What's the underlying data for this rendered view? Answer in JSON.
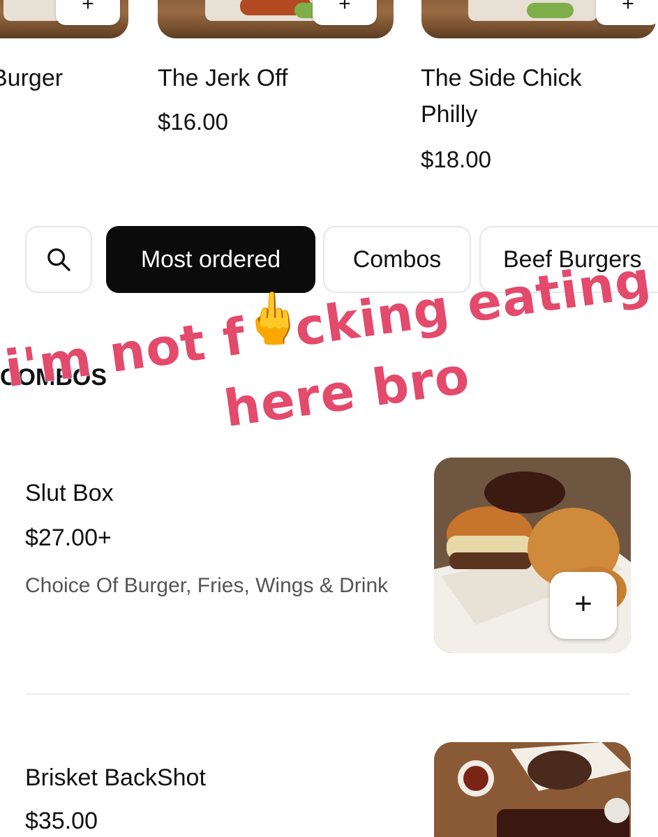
{
  "carousel": {
    "items": [
      {
        "name": "Burger",
        "price": ""
      },
      {
        "name": "The Jerk Off",
        "price": "$16.00"
      },
      {
        "name": "The Side Chick Philly",
        "price": "$18.00"
      }
    ],
    "add_glyph": "+"
  },
  "tabs": {
    "search_icon": "search-icon",
    "items": [
      "Most ordered",
      "Combos",
      "Beef Burgers"
    ],
    "active": "Most ordered"
  },
  "section": {
    "heading": "COMBOS"
  },
  "overlay": {
    "line1": "i'm not f",
    "line1b": "cking eating",
    "line2": "here bro",
    "emoji": "🖕",
    "color": "#e34a6b"
  },
  "menu": {
    "items": [
      {
        "title": "Slut Box",
        "price": "$27.00+",
        "description": "Choice Of Burger, Fries, Wings & Drink"
      },
      {
        "title": "Brisket BackShot",
        "price": "$35.00",
        "description": ""
      }
    ],
    "add_glyph": "+"
  },
  "colors": {
    "active_tab_bg": "#0b0b0b",
    "text": "#111111",
    "muted_text": "#545454"
  }
}
